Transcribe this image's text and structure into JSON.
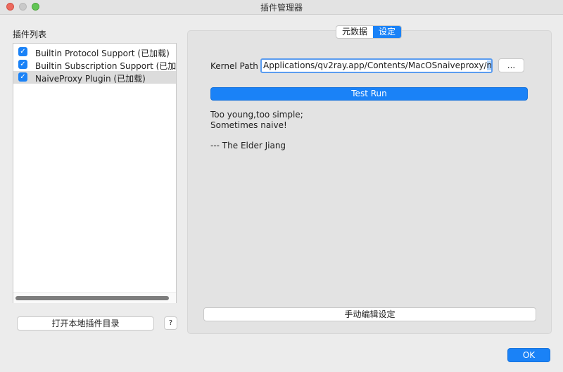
{
  "window": {
    "title": "插件管理器"
  },
  "left": {
    "label": "插件列表",
    "plugins": [
      {
        "name": "Builtin Protocol Support (已加载)",
        "checked": true,
        "selected": false
      },
      {
        "name": "Builtin Subscription Support (已加载)",
        "checked": true,
        "selected": false
      },
      {
        "name": "NaiveProxy Plugin (已加载)",
        "checked": true,
        "selected": true
      }
    ],
    "open_dir_label": "打开本地插件目录",
    "help_label": "?"
  },
  "tabs": [
    {
      "label": "元数据",
      "active": false
    },
    {
      "label": "设定",
      "active": true
    }
  ],
  "settings": {
    "kernel_label": "Kernel Path",
    "kernel_value_prefix": "Applications/qv2ray.app/Contents/MacOSnaiveproxy/",
    "kernel_value_selected": "naive",
    "browse_label": "...",
    "test_run_label": "Test Run",
    "info_lines": [
      "Too young,too simple;",
      "Sometimes naive!",
      "--- The Elder Jiang"
    ],
    "manual_edit_label": "手动编辑设定"
  },
  "footer": {
    "ok_label": "OK"
  },
  "colors": {
    "accent": "#1a82f7",
    "close": "#ec6a5e",
    "maximize": "#61c554"
  }
}
